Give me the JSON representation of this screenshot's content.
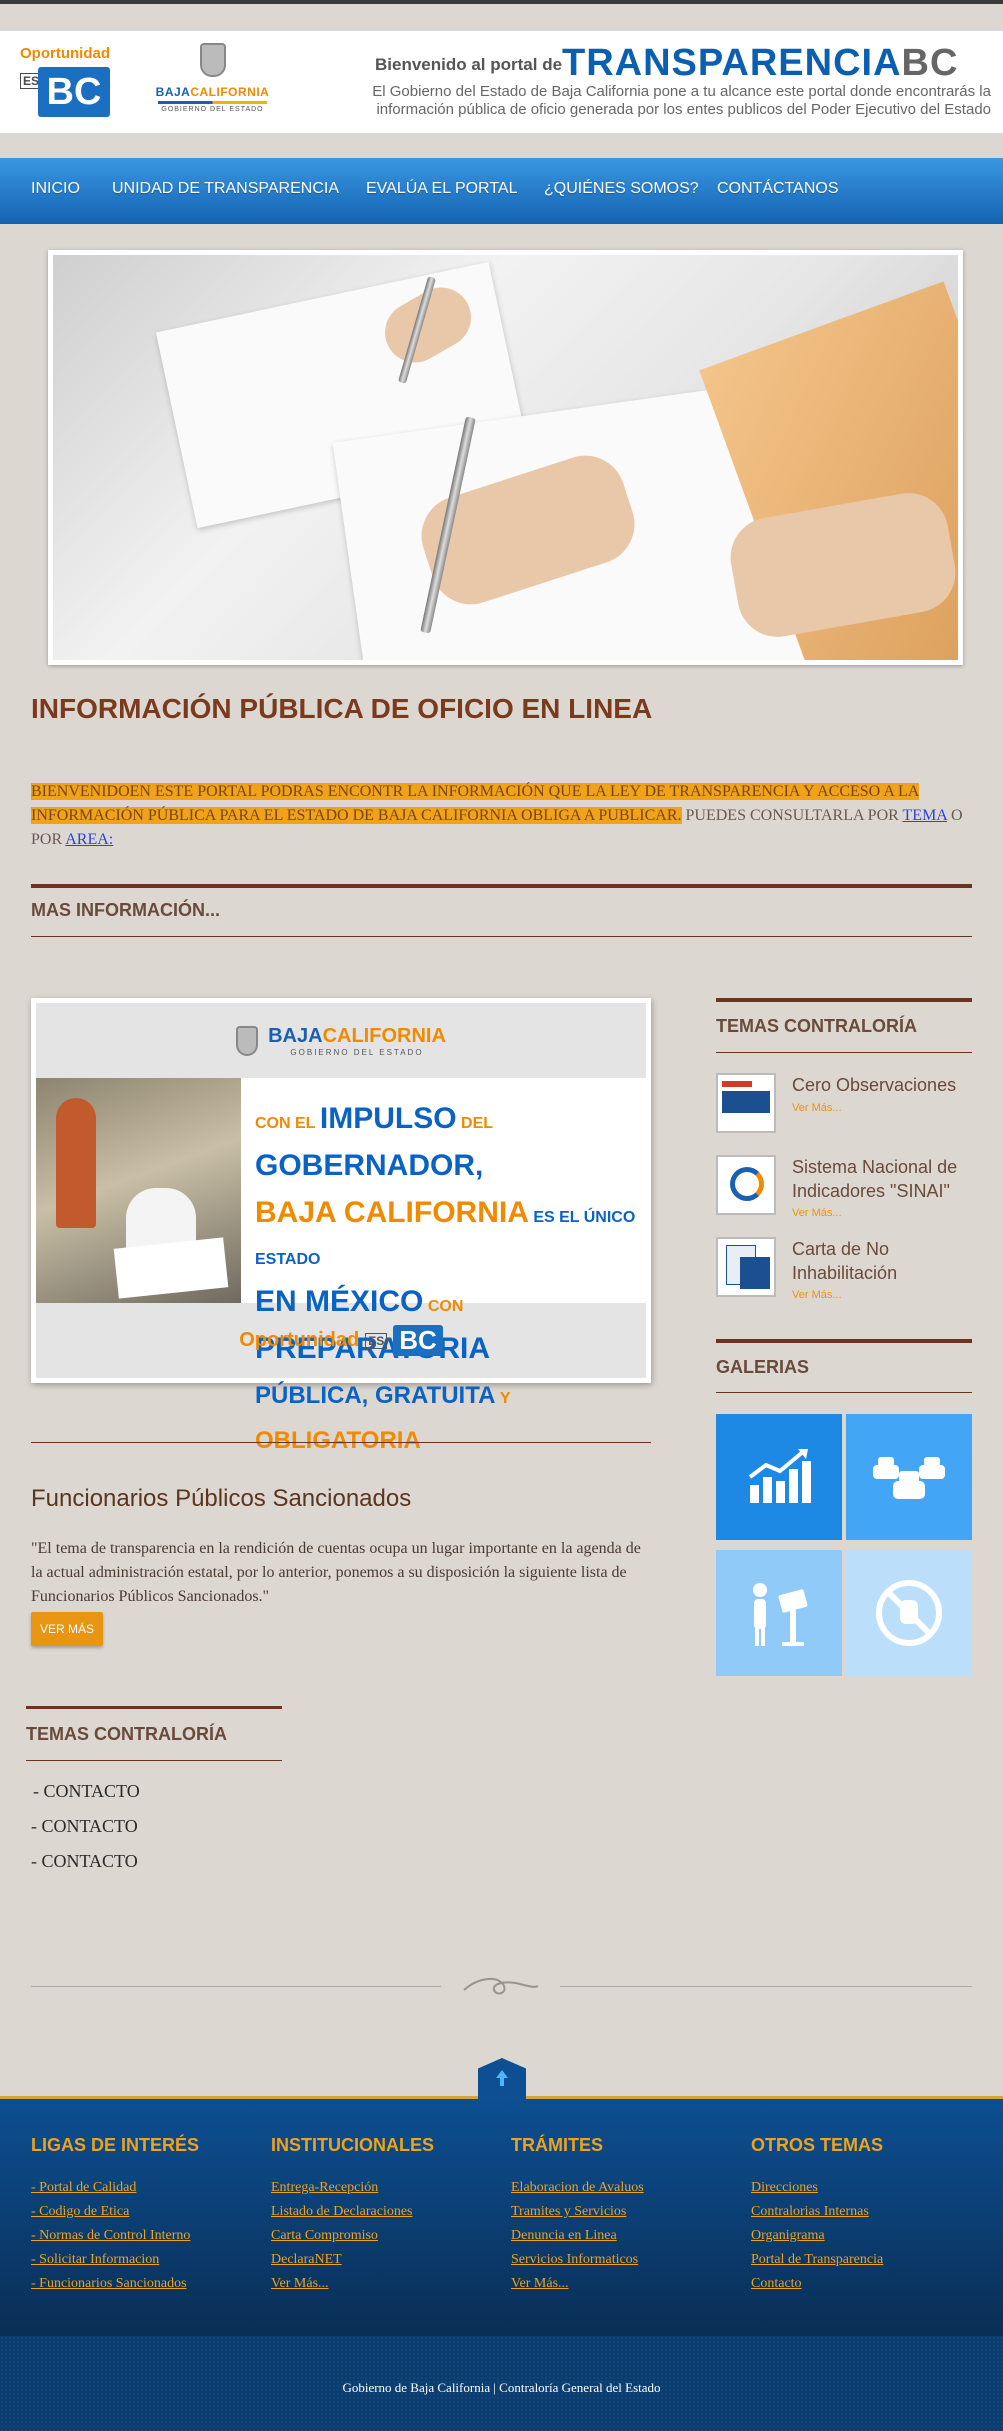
{
  "header": {
    "logo_opportunity": "Oportunidad",
    "logo_es": "ES",
    "logo_bc": "BC",
    "gov_logo_name_a": "BAJA",
    "gov_logo_name_b": "CALIFORNIA",
    "gov_logo_sub": "GOBIERNO DEL ESTADO",
    "welcome": "Bienvenido al portal de",
    "brand_main": "TRANSPARENCIA",
    "brand_suffix": "BC",
    "intro": "El Gobierno del Estado de Baja California pone a tu alcance este portal donde encontrarás la información pública de oficio generada por los entes publicos del Poder Ejecutivo del Estado"
  },
  "nav": {
    "items": [
      "INICIO",
      "UNIDAD DE TRANSPARENCIA",
      "EVALÚA EL PORTAL",
      "¿QUIÉNES SOMOS?",
      "CONTÁCTANOS"
    ]
  },
  "main": {
    "title": "INFORMACIÓN PÚBLICA DE OFICIO EN LINEA",
    "welcome_highlight": "BIENVENIDOEN ESTE PORTAL PODRAS ENCONTR LA INFORMACIÓN QUE LA LEY DE TRANSPARENCIA Y ACCESO A LA INFORMACIÓN PÚBLICA PARA EL ESTADO DE BAJA CALIFORNIA OBLIGA A PUBLICAR.",
    "welcome_rest": " PUEDES CONSULTARLA POR ",
    "link_tema": "TEMA",
    "welcome_or": " O POR ",
    "link_area": "AREA:",
    "more_info": "MAS INFORMACIÓN...",
    "banner": {
      "top_name_a": "BAJA",
      "top_name_b": "CALIFORNIA",
      "top_sub": "GOBIERNO DEL ESTADO",
      "line1_a": "CON EL",
      "line1_b": "IMPULSO",
      "line1_c": "DEL",
      "line1_d": "GOBERNADOR,",
      "line2_a": "BAJA CALIFORNIA",
      "line2_b": "ES EL ÚNICO ESTADO",
      "line3_a": "EN MÉXICO",
      "line3_b": "CON",
      "line3_c": "PREPARATORIA",
      "line4_a": "PÚBLICA, GRATUITA",
      "line4_b": "Y",
      "line4_c": "OBLIGATORIA",
      "bottom_opp": "Oportunidad",
      "bottom_es": "ES",
      "bottom_bc": "BC"
    },
    "func_title": "Funcionarios Públicos Sancionados",
    "func_text": "\"El tema de transparencia en la rendición de cuentas ocupa un lugar importante en la agenda de la actual administración estatal, por lo anterior, ponemos a su disposición la siguiente lista de Funcionarios Públicos Sancionados.\"",
    "func_button": "VER MÁS",
    "temas_title": "TEMAS CONTRALORÍA",
    "contacts": [
      "- CONTACTO",
      "- CONTACTO",
      "- CONTACTO"
    ]
  },
  "sidebar": {
    "temas_title": "TEMAS CONTRALORÍA",
    "items": [
      {
        "name": "Cero Observaciones",
        "more": "Ver Más..."
      },
      {
        "name": "Sistema Nacional de Indicadores \"SINAI\"",
        "more": "Ver Más..."
      },
      {
        "name": "Carta de No Inhabilitación",
        "more": "Ver Más..."
      }
    ],
    "galerias_title": "GALERIAS",
    "gallery_icons": [
      "chart-icon",
      "cars-icon",
      "kiosk-icon",
      "no-bribe-icon"
    ]
  },
  "footer": {
    "columns": [
      {
        "title": "LIGAS DE INTERÉS",
        "links": [
          "- Portal de Calidad",
          "- Codigo de Etica",
          "- Normas de Control Interno",
          "- Solicitar Informacion",
          "- Funcionarios Sancionados"
        ]
      },
      {
        "title": "INSTITUCIONALES",
        "links": [
          "Entrega-Recepción",
          "Listado de Declaraciones",
          "Carta Compromiso",
          "DeclaraNET",
          "Ver Más..."
        ]
      },
      {
        "title": "TRÁMITES",
        "links": [
          "Elaboracion de Avaluos",
          "Tramites y Servicios",
          "Denuncia en Linea",
          "Servicios Informaticos",
          "Ver Más..."
        ]
      },
      {
        "title": "OTROS TEMAS",
        "links": [
          "Direcciones",
          "Contralorias Internas",
          "Organigrama",
          "Portal de Transparencia",
          "Contacto"
        ]
      }
    ],
    "copyright": "Gobierno de Baja California | Contraloría General del Estado"
  },
  "colors": {
    "nav_blue": "#1463b3",
    "accent_orange": "#f0a21b",
    "title_brown": "#7a3a1e",
    "background": "#dcd7d1",
    "footer_blue": "#0a2e55"
  }
}
